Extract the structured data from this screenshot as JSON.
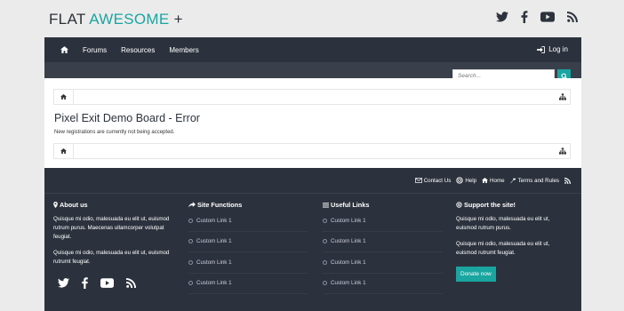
{
  "header": {
    "logo_main": "FLAT ",
    "logo_accent": "AWESOME",
    "logo_plus": " +"
  },
  "nav": {
    "forums": "Forums",
    "resources": "Resources",
    "members": "Members",
    "login": "Log in"
  },
  "search": {
    "placeholder": "Search..."
  },
  "main": {
    "title": "Pixel Exit Demo Board - Error",
    "message": "New registrations are currently not being accepted."
  },
  "footbar": {
    "links": [
      "Contact Us",
      "Help",
      "Home",
      "Terms and Rules"
    ]
  },
  "footer": {
    "about": {
      "title": "About us",
      "p1": "Quisque mi odio, malesuada eu elit ut, euismod rutrum purus. Maecenas ullamcorper volutpat feugiat.",
      "p2": "Quisque mi odio, malesuada eu elit ut, euismod rutrumt feugiat."
    },
    "site_functions": {
      "title": "Site Functions",
      "links": [
        "Custom Link 1",
        "Custom Link 1",
        "Custom Link 1",
        "Custom Link 1"
      ]
    },
    "useful_links": {
      "title": "Useful Links",
      "links": [
        "Custom Link 1",
        "Custom Link 1",
        "Custom Link 1",
        "Custom Link 1"
      ]
    },
    "support": {
      "title": "Support the site!",
      "p1": "Quisque mi odio, malesuada eu elit ut, euismod rutrum purus.",
      "p2": "Quisque mi odio, malesuada eu elit ut, euismod rutrumt feugiat.",
      "donate": "Donate now"
    }
  },
  "icons": [
    "twitter-icon",
    "facebook-icon",
    "youtube-icon",
    "rss-icon",
    "home-icon",
    "login-icon",
    "search-icon",
    "sitemap-icon",
    "envelope-icon",
    "help-icon",
    "tag-icon",
    "map-marker-icon",
    "share-icon",
    "list-icon",
    "globe-icon"
  ],
  "colors": {
    "accent": "#1aa5a0",
    "dark": "#2c323d",
    "page_bg": "#ebebeb"
  }
}
